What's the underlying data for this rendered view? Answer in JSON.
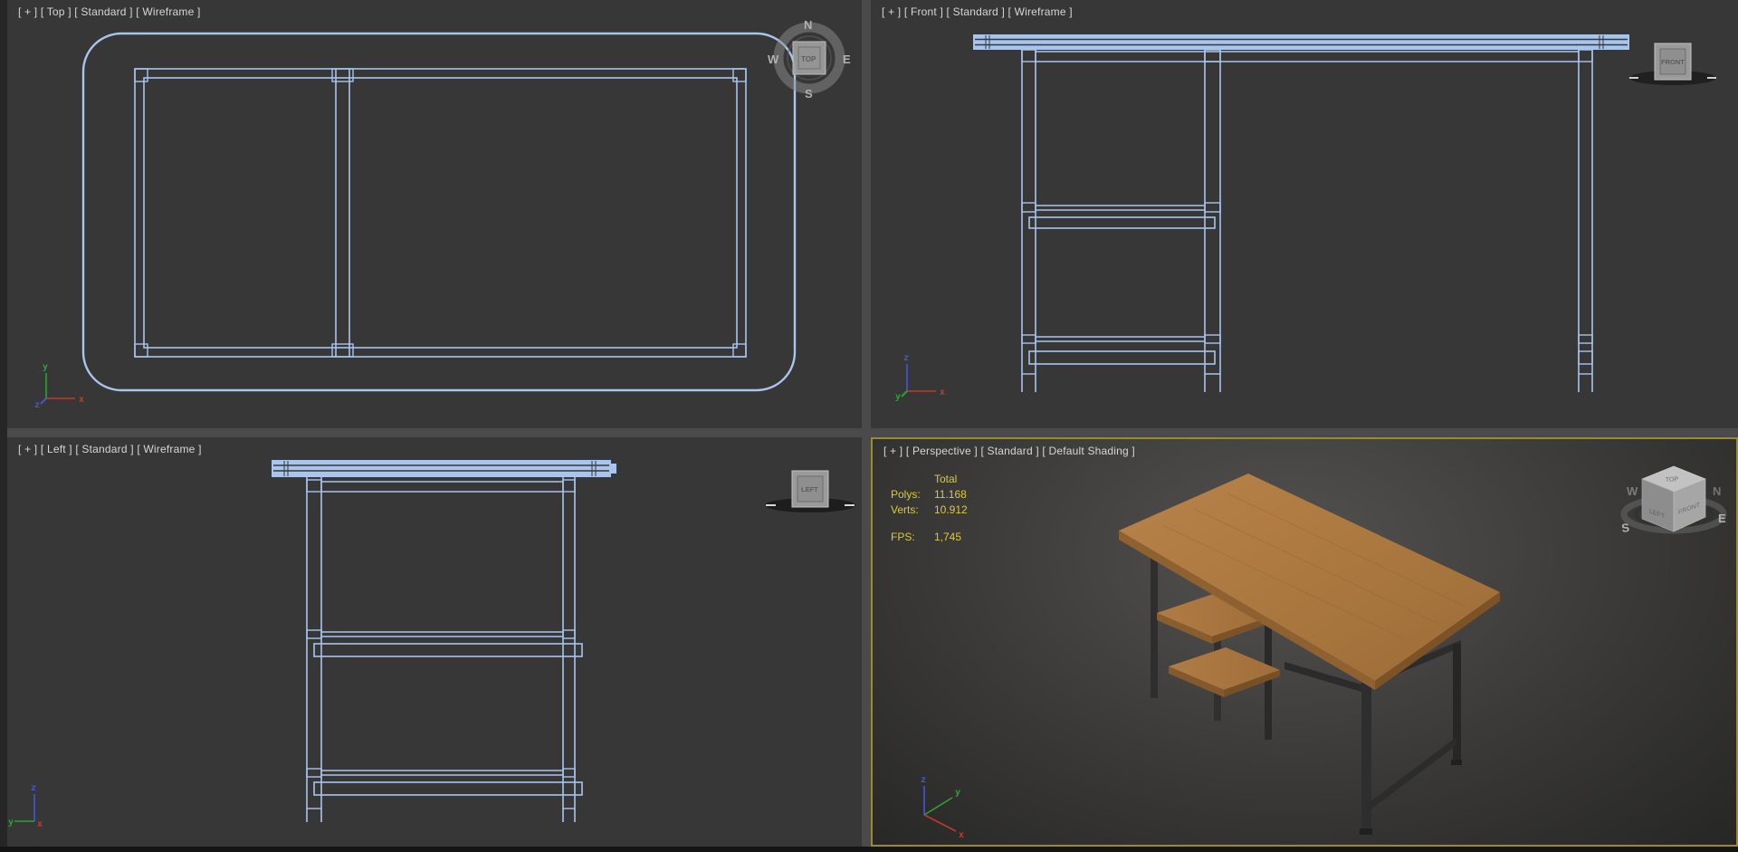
{
  "colors": {
    "wireframe": "#a9c5ec",
    "viewport_background": "#373737",
    "active_viewport_border": "#9c8a33",
    "stats_text": "#d9c93d",
    "wood": "#ad7a42"
  },
  "viewports": {
    "top": {
      "label": "[ + ] [ Top ] [ Standard ] [ Wireframe ]",
      "viewcube": {
        "face": "TOP",
        "compass": {
          "n": "N",
          "w": "W",
          "e": "E",
          "s": "S"
        }
      },
      "axes": {
        "x": "x",
        "y": "y",
        "z": "z"
      }
    },
    "front": {
      "label": "[ + ] [ Front ] [ Standard ] [ Wireframe ]",
      "viewcube": {
        "face": "FRONT"
      },
      "axes": {
        "x": "x",
        "y": "y",
        "z": "z"
      }
    },
    "left": {
      "label": "[ + ] [ Left ] [ Standard ] [ Wireframe ]",
      "viewcube": {
        "face": "LEFT"
      },
      "axes": {
        "x": "x",
        "y": "y",
        "z": "z"
      }
    },
    "perspective": {
      "label": "[ + ] [ Perspective ] [ Standard ] [ Default Shading ]",
      "stats": {
        "header": "Total",
        "rows": [
          {
            "label": "Polys:",
            "value": "11.168"
          },
          {
            "label": "Verts:",
            "value": "10.912"
          }
        ],
        "fps": {
          "label": "FPS:",
          "value": "1,745"
        }
      },
      "viewcube": {
        "top_face": "TOP",
        "left_face": "LEFT",
        "front_face": "FRONT",
        "compass": {
          "s": "S",
          "e": "E",
          "w": "W",
          "n": "N"
        }
      },
      "axes": {
        "x": "x",
        "y": "y",
        "z": "z"
      }
    }
  }
}
